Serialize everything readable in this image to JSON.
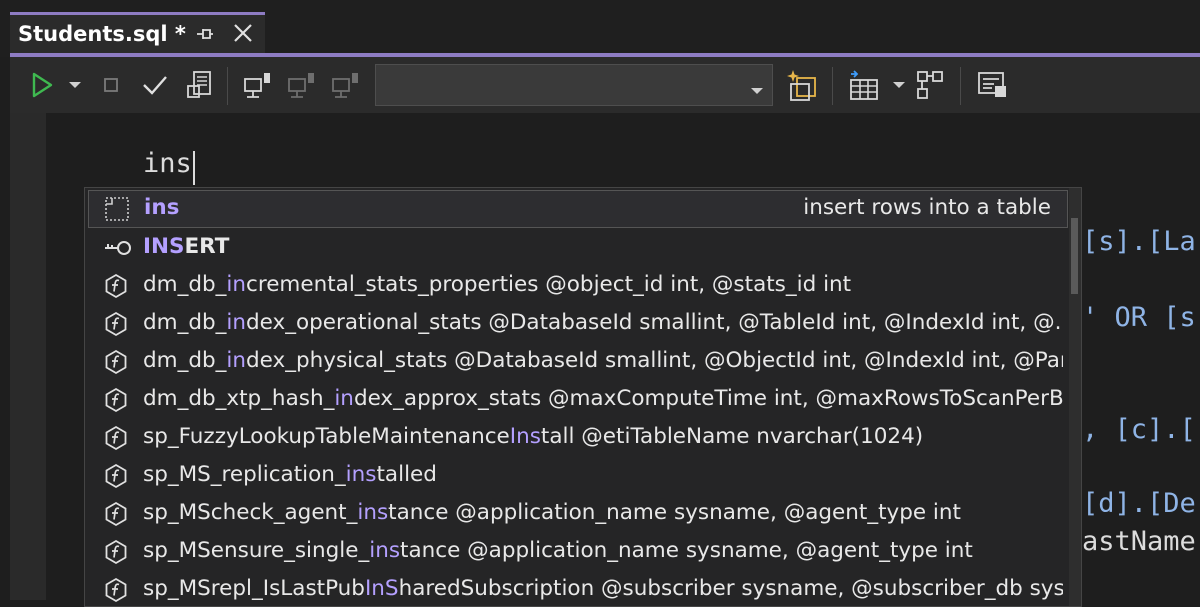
{
  "tab": {
    "title": "Students.sql *"
  },
  "toolbar": {
    "database_select": {
      "value": ""
    }
  },
  "editor": {
    "typed_text": "ins",
    "background_code": [
      "[s].[La",
      "' OR [s",
      ", [c].[",
      "[d].[De",
      "astName"
    ]
  },
  "completion": {
    "items": [
      {
        "icon": "snippet-icon",
        "pre": "",
        "match": "ins",
        "post": "",
        "bold": true,
        "description": "insert rows into a table",
        "selected": true
      },
      {
        "icon": "keyword-icon",
        "pre": "",
        "match": "INS",
        "post": "ERT",
        "bold": true,
        "description": "",
        "selected": false
      },
      {
        "icon": "function-icon",
        "pre": "dm_db_",
        "match": "in",
        "post": "cremental_stats_properties @object_id int, @stats_id int",
        "bold": false,
        "description": "",
        "selected": false
      },
      {
        "icon": "function-icon",
        "pre": "dm_db_",
        "match": "in",
        "post": "dex_operational_stats @DatabaseId smallint, @TableId int, @IndexId int, @...",
        "bold": false,
        "description": "",
        "selected": false
      },
      {
        "icon": "function-icon",
        "pre": "dm_db_",
        "match": "in",
        "post": "dex_physical_stats @DatabaseId smallint, @ObjectId int, @IndexId int, @Par...",
        "bold": false,
        "description": "",
        "selected": false
      },
      {
        "icon": "function-icon",
        "pre": "dm_db_xtp_hash_",
        "match": "in",
        "post": "dex_approx_stats @maxComputeTime int, @maxRowsToScanPerB...",
        "bold": false,
        "description": "",
        "selected": false
      },
      {
        "icon": "function-icon",
        "pre": "sp_FuzzyLookupTableMaintenance",
        "match": "Ins",
        "post": "tall @etiTableName nvarchar(1024)",
        "bold": false,
        "description": "",
        "selected": false
      },
      {
        "icon": "function-icon",
        "pre": "sp_MS_replication_",
        "match": "ins",
        "post": "talled",
        "bold": false,
        "description": "",
        "selected": false
      },
      {
        "icon": "function-icon",
        "pre": "sp_MScheck_agent_",
        "match": "ins",
        "post": "tance @application_name sysname, @agent_type int",
        "bold": false,
        "description": "",
        "selected": false
      },
      {
        "icon": "function-icon",
        "pre": "sp_MSensure_single_",
        "match": "ins",
        "post": "tance @application_name sysname, @agent_type int",
        "bold": false,
        "description": "",
        "selected": false
      },
      {
        "icon": "function-icon",
        "pre": "sp_MSrepl_IsLastPub",
        "match": "InS",
        "post": "haredSubscription @subscriber sysname, @subscriber_db sys...",
        "bold": false,
        "description": "",
        "selected": false
      }
    ]
  },
  "colors": {
    "accent": "#8e7cc3",
    "match": "#b4a0ff",
    "run_green": "#3fb950"
  }
}
